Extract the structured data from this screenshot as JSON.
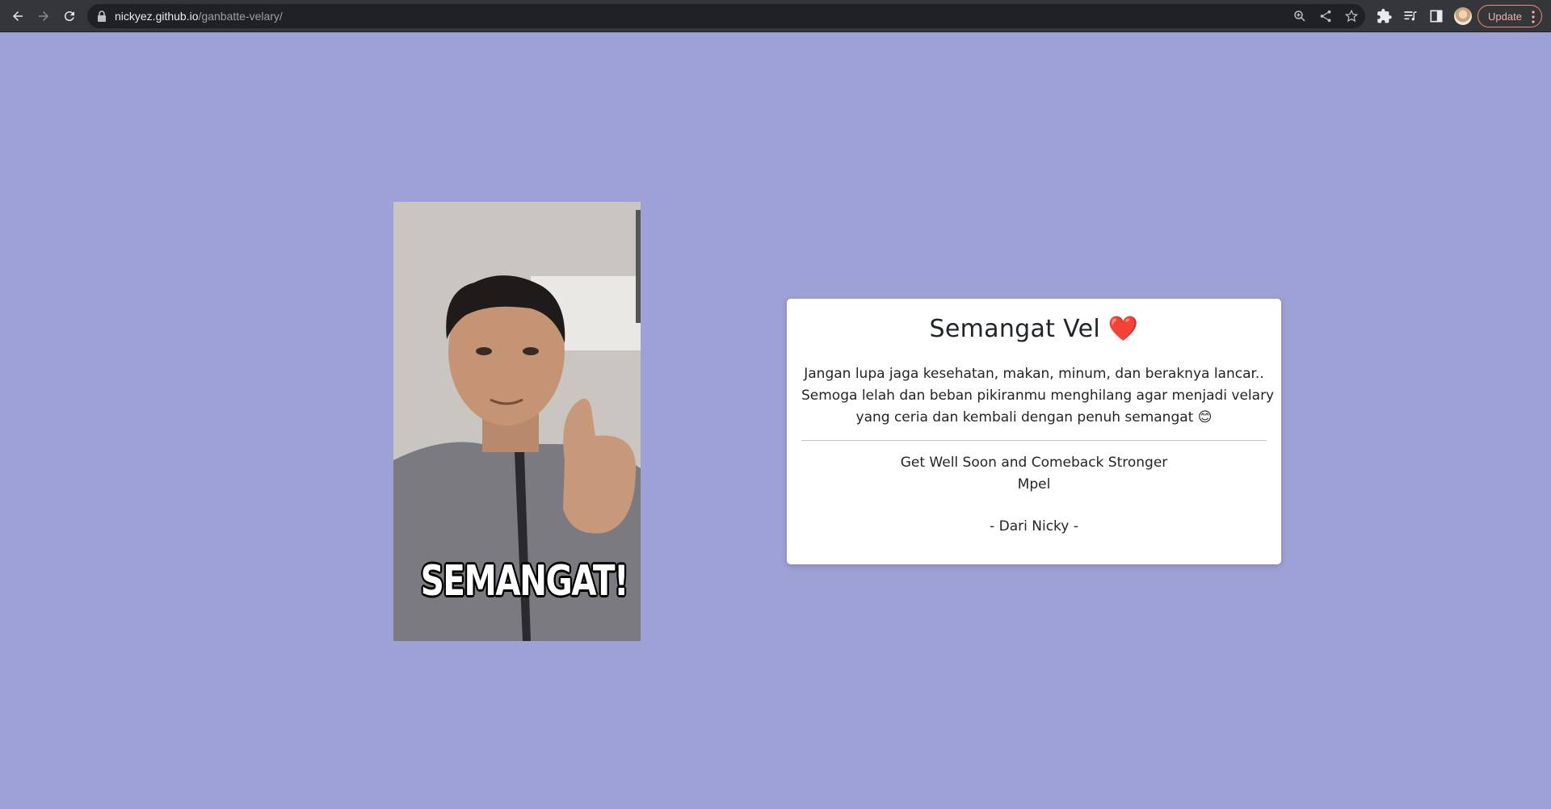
{
  "browser": {
    "url_host": "nickyez.github.io",
    "url_path": "/ganbatte-velary/",
    "update_label": "Update"
  },
  "page": {
    "background": "#9ea1d5",
    "photo": {
      "caption": "SEMANGAT!"
    },
    "card": {
      "title": "Semangat Vel",
      "title_emoji": "❤️",
      "message_lines": [
        "Jangan lupa jaga kesehatan, makan, minum, dan beraknya lancar..",
        "Semoga lelah dan beban pikiranmu menghilang agar menjadi velary",
        "yang ceria dan kembali dengan penuh semangat 😊"
      ],
      "signoff_lines": [
        "Get Well Soon and Comeback Stronger",
        "Mpel"
      ],
      "from": "- Dari Nicky -"
    }
  }
}
